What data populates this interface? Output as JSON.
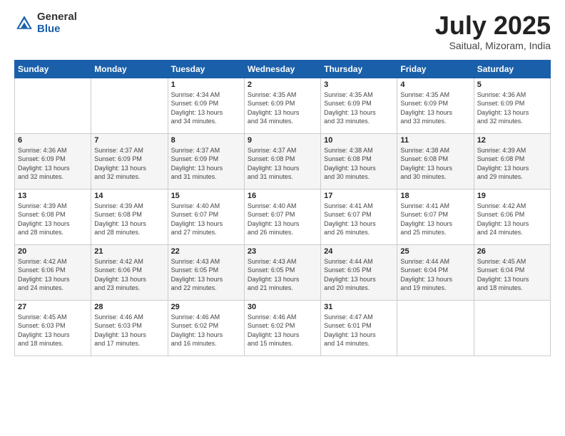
{
  "header": {
    "logo_general": "General",
    "logo_blue": "Blue",
    "title": "July 2025",
    "location": "Saitual, Mizoram, India"
  },
  "weekdays": [
    "Sunday",
    "Monday",
    "Tuesday",
    "Wednesday",
    "Thursday",
    "Friday",
    "Saturday"
  ],
  "weeks": [
    [
      {
        "day": "",
        "info": ""
      },
      {
        "day": "",
        "info": ""
      },
      {
        "day": "1",
        "info": "Sunrise: 4:34 AM\nSunset: 6:09 PM\nDaylight: 13 hours\nand 34 minutes."
      },
      {
        "day": "2",
        "info": "Sunrise: 4:35 AM\nSunset: 6:09 PM\nDaylight: 13 hours\nand 34 minutes."
      },
      {
        "day": "3",
        "info": "Sunrise: 4:35 AM\nSunset: 6:09 PM\nDaylight: 13 hours\nand 33 minutes."
      },
      {
        "day": "4",
        "info": "Sunrise: 4:35 AM\nSunset: 6:09 PM\nDaylight: 13 hours\nand 33 minutes."
      },
      {
        "day": "5",
        "info": "Sunrise: 4:36 AM\nSunset: 6:09 PM\nDaylight: 13 hours\nand 32 minutes."
      }
    ],
    [
      {
        "day": "6",
        "info": "Sunrise: 4:36 AM\nSunset: 6:09 PM\nDaylight: 13 hours\nand 32 minutes."
      },
      {
        "day": "7",
        "info": "Sunrise: 4:37 AM\nSunset: 6:09 PM\nDaylight: 13 hours\nand 32 minutes."
      },
      {
        "day": "8",
        "info": "Sunrise: 4:37 AM\nSunset: 6:09 PM\nDaylight: 13 hours\nand 31 minutes."
      },
      {
        "day": "9",
        "info": "Sunrise: 4:37 AM\nSunset: 6:08 PM\nDaylight: 13 hours\nand 31 minutes."
      },
      {
        "day": "10",
        "info": "Sunrise: 4:38 AM\nSunset: 6:08 PM\nDaylight: 13 hours\nand 30 minutes."
      },
      {
        "day": "11",
        "info": "Sunrise: 4:38 AM\nSunset: 6:08 PM\nDaylight: 13 hours\nand 30 minutes."
      },
      {
        "day": "12",
        "info": "Sunrise: 4:39 AM\nSunset: 6:08 PM\nDaylight: 13 hours\nand 29 minutes."
      }
    ],
    [
      {
        "day": "13",
        "info": "Sunrise: 4:39 AM\nSunset: 6:08 PM\nDaylight: 13 hours\nand 28 minutes."
      },
      {
        "day": "14",
        "info": "Sunrise: 4:39 AM\nSunset: 6:08 PM\nDaylight: 13 hours\nand 28 minutes."
      },
      {
        "day": "15",
        "info": "Sunrise: 4:40 AM\nSunset: 6:07 PM\nDaylight: 13 hours\nand 27 minutes."
      },
      {
        "day": "16",
        "info": "Sunrise: 4:40 AM\nSunset: 6:07 PM\nDaylight: 13 hours\nand 26 minutes."
      },
      {
        "day": "17",
        "info": "Sunrise: 4:41 AM\nSunset: 6:07 PM\nDaylight: 13 hours\nand 26 minutes."
      },
      {
        "day": "18",
        "info": "Sunrise: 4:41 AM\nSunset: 6:07 PM\nDaylight: 13 hours\nand 25 minutes."
      },
      {
        "day": "19",
        "info": "Sunrise: 4:42 AM\nSunset: 6:06 PM\nDaylight: 13 hours\nand 24 minutes."
      }
    ],
    [
      {
        "day": "20",
        "info": "Sunrise: 4:42 AM\nSunset: 6:06 PM\nDaylight: 13 hours\nand 24 minutes."
      },
      {
        "day": "21",
        "info": "Sunrise: 4:42 AM\nSunset: 6:06 PM\nDaylight: 13 hours\nand 23 minutes."
      },
      {
        "day": "22",
        "info": "Sunrise: 4:43 AM\nSunset: 6:05 PM\nDaylight: 13 hours\nand 22 minutes."
      },
      {
        "day": "23",
        "info": "Sunrise: 4:43 AM\nSunset: 6:05 PM\nDaylight: 13 hours\nand 21 minutes."
      },
      {
        "day": "24",
        "info": "Sunrise: 4:44 AM\nSunset: 6:05 PM\nDaylight: 13 hours\nand 20 minutes."
      },
      {
        "day": "25",
        "info": "Sunrise: 4:44 AM\nSunset: 6:04 PM\nDaylight: 13 hours\nand 19 minutes."
      },
      {
        "day": "26",
        "info": "Sunrise: 4:45 AM\nSunset: 6:04 PM\nDaylight: 13 hours\nand 18 minutes."
      }
    ],
    [
      {
        "day": "27",
        "info": "Sunrise: 4:45 AM\nSunset: 6:03 PM\nDaylight: 13 hours\nand 18 minutes."
      },
      {
        "day": "28",
        "info": "Sunrise: 4:46 AM\nSunset: 6:03 PM\nDaylight: 13 hours\nand 17 minutes."
      },
      {
        "day": "29",
        "info": "Sunrise: 4:46 AM\nSunset: 6:02 PM\nDaylight: 13 hours\nand 16 minutes."
      },
      {
        "day": "30",
        "info": "Sunrise: 4:46 AM\nSunset: 6:02 PM\nDaylight: 13 hours\nand 15 minutes."
      },
      {
        "day": "31",
        "info": "Sunrise: 4:47 AM\nSunset: 6:01 PM\nDaylight: 13 hours\nand 14 minutes."
      },
      {
        "day": "",
        "info": ""
      },
      {
        "day": "",
        "info": ""
      }
    ]
  ]
}
